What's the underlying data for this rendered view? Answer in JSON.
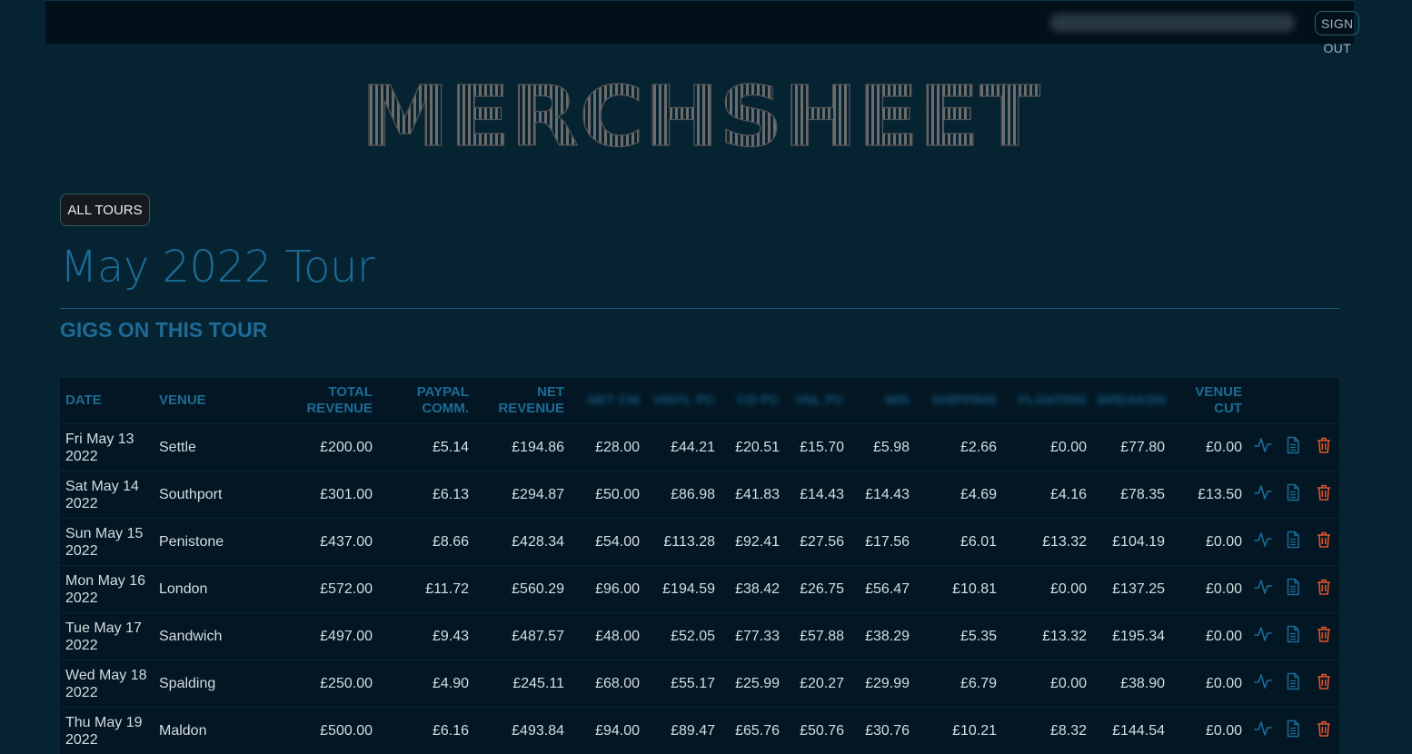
{
  "header": {
    "email": "blurred-email@example.com",
    "sign_out_label": "SIGN OUT"
  },
  "logo": {
    "text": "MERCHSHEET"
  },
  "nav": {
    "all_tours_label": "ALL TOURS"
  },
  "page": {
    "title": "May 2022 Tour",
    "section_title": "GIGS ON THIS TOUR"
  },
  "colors": {
    "background": "#062332",
    "accent": "#1d6b96",
    "delete": "#e0542f"
  },
  "table": {
    "columns": [
      {
        "label": "DATE"
      },
      {
        "label": "VENUE"
      },
      {
        "label": "TOTAL REVENUE"
      },
      {
        "label": "PAYPAL COMM."
      },
      {
        "label": "NET REVENUE"
      },
      {
        "label": "NET CM"
      },
      {
        "label": "VINYL PC"
      },
      {
        "label": "CD PC"
      },
      {
        "label": "VNL PC"
      },
      {
        "label": "MIS"
      },
      {
        "label": "SHIPPING"
      },
      {
        "label": "FLOATING"
      },
      {
        "label": "BREAKDN"
      },
      {
        "label": "VENUE CUT"
      }
    ],
    "rows": [
      {
        "date": "Fri May 13 2022",
        "venue": "Settle",
        "c1": "£200.00",
        "c2": "£5.14",
        "c3": "£194.86",
        "c4": "£28.00",
        "c5": "£44.21",
        "c6": "£20.51",
        "c7": "£15.70",
        "c8": "£5.98",
        "c9": "£2.66",
        "c10": "£0.00",
        "c11": "£77.80",
        "c12": "£0.00"
      },
      {
        "date": "Sat May 14 2022",
        "venue": "Southport",
        "c1": "£301.00",
        "c2": "£6.13",
        "c3": "£294.87",
        "c4": "£50.00",
        "c5": "£86.98",
        "c6": "£41.83",
        "c7": "£14.43",
        "c8": "£14.43",
        "c9": "£4.69",
        "c10": "£4.16",
        "c11": "£78.35",
        "c12": "£13.50"
      },
      {
        "date": "Sun May 15 2022",
        "venue": "Penistone",
        "c1": "£437.00",
        "c2": "£8.66",
        "c3": "£428.34",
        "c4": "£54.00",
        "c5": "£113.28",
        "c6": "£92.41",
        "c7": "£27.56",
        "c8": "£17.56",
        "c9": "£6.01",
        "c10": "£13.32",
        "c11": "£104.19",
        "c12": "£0.00"
      },
      {
        "date": "Mon May 16 2022",
        "venue": "London",
        "c1": "£572.00",
        "c2": "£11.72",
        "c3": "£560.29",
        "c4": "£96.00",
        "c5": "£194.59",
        "c6": "£38.42",
        "c7": "£26.75",
        "c8": "£56.47",
        "c9": "£10.81",
        "c10": "£0.00",
        "c11": "£137.25",
        "c12": "£0.00"
      },
      {
        "date": "Tue May 17 2022",
        "venue": "Sandwich",
        "c1": "£497.00",
        "c2": "£9.43",
        "c3": "£487.57",
        "c4": "£48.00",
        "c5": "£52.05",
        "c6": "£77.33",
        "c7": "£57.88",
        "c8": "£38.29",
        "c9": "£5.35",
        "c10": "£13.32",
        "c11": "£195.34",
        "c12": "£0.00"
      },
      {
        "date": "Wed May 18 2022",
        "venue": "Spalding",
        "c1": "£250.00",
        "c2": "£4.90",
        "c3": "£245.11",
        "c4": "£68.00",
        "c5": "£55.17",
        "c6": "£25.99",
        "c7": "£20.27",
        "c8": "£29.99",
        "c9": "£6.79",
        "c10": "£0.00",
        "c11": "£38.90",
        "c12": "£0.00"
      },
      {
        "date": "Thu May 19 2022",
        "venue": "Maldon",
        "c1": "£500.00",
        "c2": "£6.16",
        "c3": "£493.84",
        "c4": "£94.00",
        "c5": "£89.47",
        "c6": "£65.76",
        "c7": "£50.76",
        "c8": "£30.76",
        "c9": "£10.21",
        "c10": "£8.32",
        "c11": "£144.54",
        "c12": "£0.00"
      }
    ],
    "row_actions": [
      "activity-icon",
      "document-icon",
      "trash-icon"
    ]
  }
}
